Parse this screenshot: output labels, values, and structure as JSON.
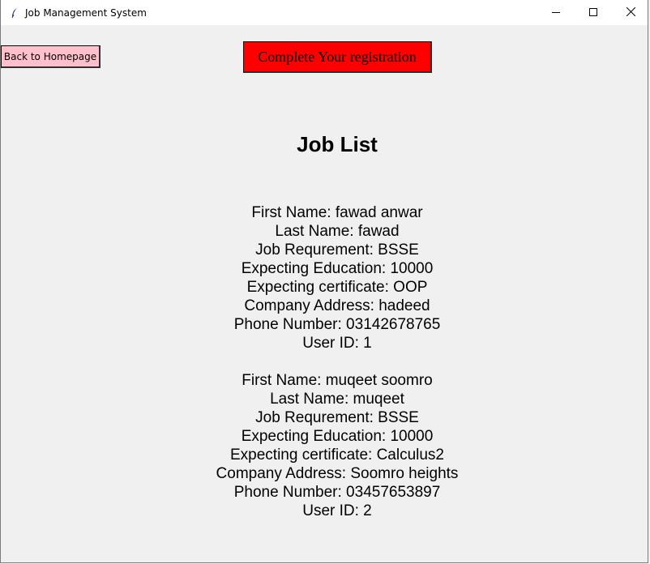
{
  "window": {
    "title": "Job Management System",
    "icon": "feather-icon",
    "controls": [
      "minimize-icon",
      "maximize-icon",
      "close-icon"
    ]
  },
  "toolbar": {
    "back_label": "Back to Homepage",
    "register_label": "Complete Your registration"
  },
  "colors": {
    "back_button": "#ffc0cb",
    "register_button": "#ff0000",
    "background": "#f0f0f0"
  },
  "main": {
    "heading": "Job List",
    "jobs": [
      {
        "first_name": "First Name: fawad anwar",
        "last_name": "Last Name: fawad",
        "job_requirement": "Job Requrement: BSSE",
        "expecting_education": "Expecting Education: 10000",
        "expecting_certificate": "Expecting certificate: OOP",
        "company_address": "Company Address: hadeed",
        "phone_number": "Phone Number: 03142678765",
        "user_id": "User ID: 1"
      },
      {
        "first_name": "First Name: muqeet soomro",
        "last_name": "Last Name: muqeet",
        "job_requirement": "Job Requrement: BSSE",
        "expecting_education": "Expecting Education: 10000",
        "expecting_certificate": "Expecting certificate: Calculus2",
        "company_address": "Company Address: Soomro heights",
        "phone_number": "Phone Number: 03457653897",
        "user_id": "User ID: 2"
      }
    ]
  }
}
